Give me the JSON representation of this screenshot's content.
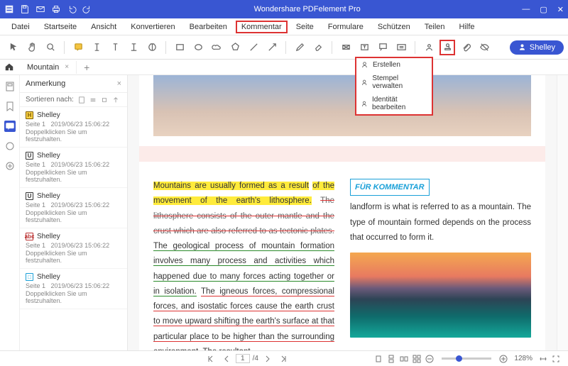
{
  "app": {
    "title": "Wondershare PDFelement Pro"
  },
  "menu": [
    "Datei",
    "Startseite",
    "Ansicht",
    "Konvertieren",
    "Bearbeiten",
    "Kommentar",
    "Seite",
    "Formulare",
    "Schützen",
    "Teilen",
    "Hilfe"
  ],
  "menu_active_index": 5,
  "user": {
    "name": "Shelley"
  },
  "dropdown": {
    "items": [
      "Erstellen",
      "Stempel verwalten",
      "Identität bearbeiten"
    ]
  },
  "doc_tab": {
    "name": "Mountain"
  },
  "panel": {
    "title": "Anmerkung",
    "sort_label": "Sortieren nach:",
    "annotations": [
      {
        "type": "H",
        "badge_bg": "#ffd54a",
        "badge_fg": "#7a5a00",
        "author": "Shelley",
        "page": "Seite 1",
        "ts": "2019/06/23 15:06:22",
        "hint": "Doppelklicken Sie um festzuhalten."
      },
      {
        "type": "U",
        "badge_bg": "#ffffff",
        "badge_fg": "#333",
        "author": "Shelley",
        "page": "Seite 1",
        "ts": "2019/06/23 15:06:22",
        "hint": "Doppelklicken Sie um festzuhalten."
      },
      {
        "type": "U",
        "badge_bg": "#ffffff",
        "badge_fg": "#333",
        "author": "Shelley",
        "page": "Seite 1",
        "ts": "2019/06/23 15:06:22",
        "hint": "Doppelklicken Sie um festzuhalten."
      },
      {
        "type": "abc",
        "badge_bg": "#ffffff",
        "badge_fg": "#b33",
        "author": "Shelley",
        "page": "Seite 1",
        "ts": "2019/06/23 15:06:22",
        "hint": "Doppelklicken Sie um festzuhalten."
      },
      {
        "type": "□",
        "badge_bg": "#ffffff",
        "badge_fg": "#1aa0d8",
        "author": "Shelley",
        "page": "Seite 1",
        "ts": "2019/06/23 15:06:22",
        "hint": "Doppelklicken Sie um festzuhalten."
      }
    ]
  },
  "document": {
    "col1": {
      "hl1": "Mountains are usually formed as a result",
      "hl2": "of the movement of the earth's lithosphere.",
      "strike": "The lithosphere consists of the outer mantle and the crust which are also referred to as tectonic plates.",
      "green": "The geological process of mountain formation involves many process and activities which happened due to many forces acting together or in isolation.",
      "red": "The igneous forces, compressional forces, and isostatic forces cause the earth crust to move upward shifting the earth's surface at that particular place to be higher than the surrounding environment.",
      "tail": " The resultant"
    },
    "col2": {
      "heading": "FÜR KOMMENTAR",
      "para": "landform is what is referred to as a mountain. The type of mountain formed depends on the process that occurred to form it."
    }
  },
  "status": {
    "page_current": "1",
    "page_total": "/4",
    "zoom": "128%"
  }
}
